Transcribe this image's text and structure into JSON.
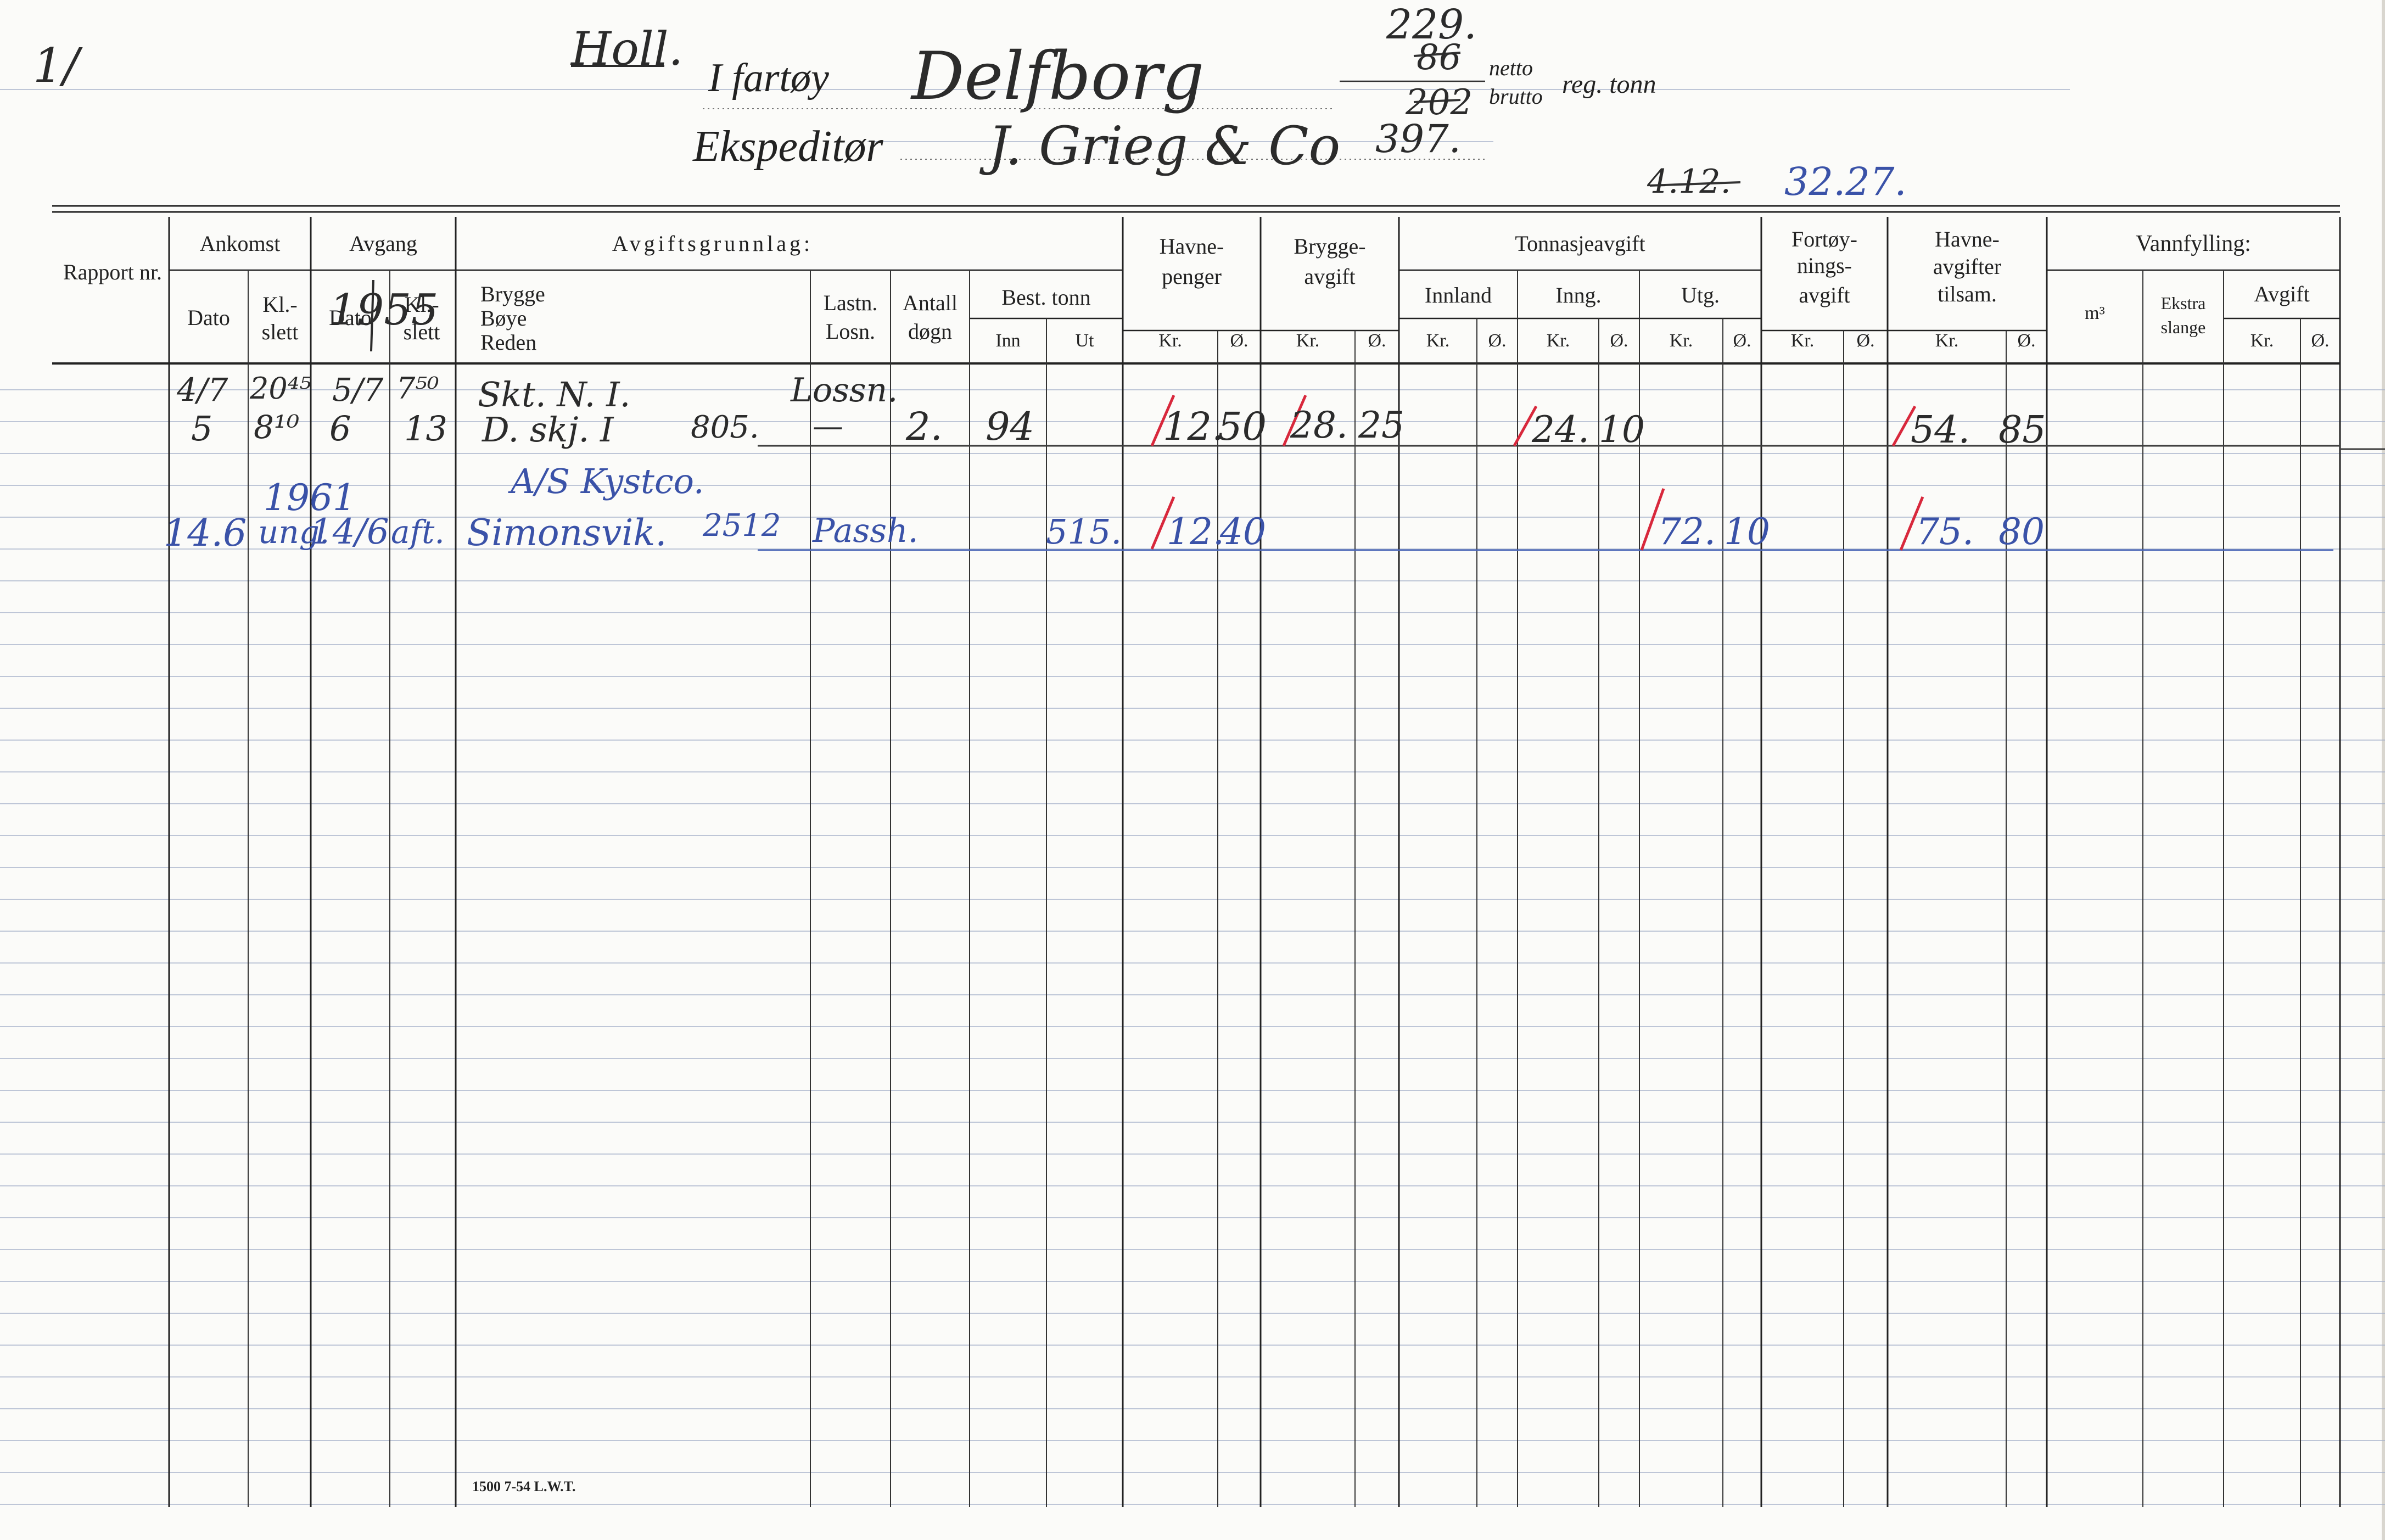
{
  "form": {
    "corner_mark": "1/",
    "fartoy_label": "I fartøy",
    "ekspeditor_label": "Ekspeditør",
    "netto_label": "netto",
    "brutto_label": "brutto",
    "reg_tonn_label": "reg. tonn",
    "print_code": "1500 7-54 L.W.T."
  },
  "vessel": {
    "location": "Holl.",
    "name": "Delfborg",
    "expeditor": "J. Grieg & Co",
    "tonnage_top": "229.",
    "netto_value": "86",
    "brutto_value": "202",
    "tonnage_bottom": "397.",
    "old_ref": "4.12.",
    "new_ref": "32.27."
  },
  "headers": {
    "rapport": "Rapport nr.",
    "ankomst": "Ankomst",
    "avgang": "Avgang",
    "dato": "Dato",
    "klslett": "Kl.- slett",
    "avgiftsgrunnlag": "Avgiftsgrunnlag:",
    "brygge": "Brygge",
    "boye": "Bøye",
    "reden": "Reden",
    "lastn": "Lastn.",
    "losn": "Losn.",
    "antall": "Antall",
    "dogn": "døgn",
    "best_tonn": "Best. tonn",
    "inn": "Inn",
    "ut": "Ut",
    "havnepenger_1": "Havne-",
    "havnepenger_2": "penger",
    "bryggeavgift_1": "Brygge-",
    "bryggeavgift_2": "avgift",
    "tonnasjeavgift": "Tonnasjeavgift",
    "innland": "Innland",
    "inng": "Inng.",
    "utg": "Utg.",
    "fortoy_1": "Fortøy-",
    "fortoy_2": "nings-",
    "fortoy_3": "avgift",
    "havneavg_1": "Havne-",
    "havneavg_2": "avgifter",
    "havneavg_3": "tilsam.",
    "vannfylling": "Vannfylling:",
    "m3": "m³",
    "ekstra_1": "Ekstra",
    "ekstra_2": "slange",
    "avgift": "Avgift",
    "kr": "Kr.",
    "ore": "Ø."
  },
  "entries": [
    {
      "ank_dato_1": "4/7",
      "ank_kl_1": "20⁴⁵",
      "avg_dato_1": "5/7",
      "avg_kl_1": "7⁵⁰",
      "brygge_1": "Skt. N. I.",
      "lastn_1": "Lossn.",
      "ank_dato_2": "5",
      "ank_kl_2": "8¹⁰",
      "avg_dato_2": "6",
      "avg_kl_2": "13",
      "brygge_2": "D. skj. I",
      "ton_note": "805.",
      "lastn_2": "—",
      "antall": "2.",
      "best_inn": "94",
      "havnepenger_kr": "12.",
      "havnepenger_ore": "50",
      "bryggeavgift_kr": "28.",
      "bryggeavgift_ore": "25",
      "inng_kr": "24.",
      "inng_ore": "10",
      "tilsam_kr": "54.",
      "tilsam_ore": "85",
      "year_note": "1955"
    },
    {
      "company": "A/S Kystco.",
      "year_note": "1961",
      "ank_dato": "14.6",
      "ank_kl": "ung.",
      "avg_dato": "14/6",
      "avg_kl": "aft.",
      "brygge": "Simonsvik.",
      "ton_note": "2512",
      "lastn": "Passh.",
      "best_ut": "515.",
      "havnepenger_kr": "12.",
      "havnepenger_ore": "40",
      "utg_kr": "72.",
      "utg_ore": "10",
      "tilsam_kr": "75.",
      "tilsam_ore": "80"
    }
  ]
}
